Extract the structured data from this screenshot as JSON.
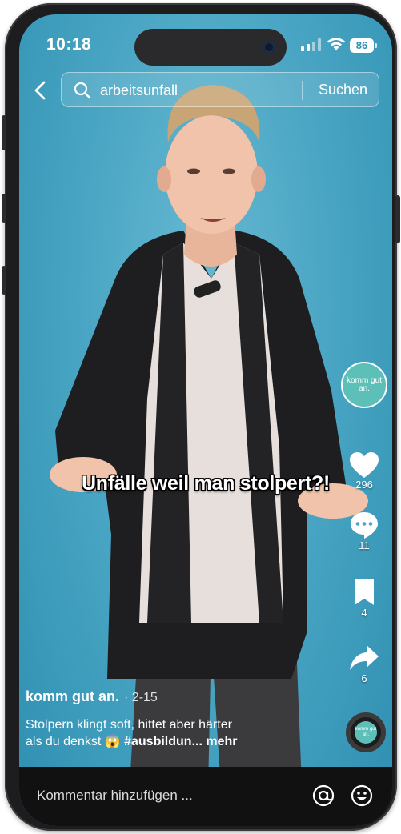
{
  "status": {
    "time": "10:18",
    "battery": "86"
  },
  "search": {
    "query": "arbeitsunfall",
    "button": "Suchen"
  },
  "video": {
    "caption": "Unfälle weil man stolpert?!"
  },
  "account": {
    "avatar_text": "komm gut an.",
    "name": "komm gut an.",
    "date": "· 2-15"
  },
  "actions": {
    "likes": "296",
    "comments": "11",
    "saves": "4",
    "shares": "6"
  },
  "description": {
    "line1": "Stolpern klingt soft, hittet aber härter",
    "line2_prefix": "als du denkst",
    "emoji": "😱",
    "hashtag": "#ausbildun...",
    "more": "mehr"
  },
  "comment_bar": {
    "placeholder": "Kommentar hinzufügen ..."
  },
  "icons": [
    "back-arrow-icon",
    "search-icon",
    "heart-icon",
    "comment-icon",
    "bookmark-icon",
    "share-icon",
    "at-icon",
    "emoji-icon",
    "signal-icon",
    "wifi-icon"
  ],
  "colors": {
    "background": "#4aa6c4",
    "brand_teal": "#5dc0b8",
    "bar": "#111111"
  }
}
